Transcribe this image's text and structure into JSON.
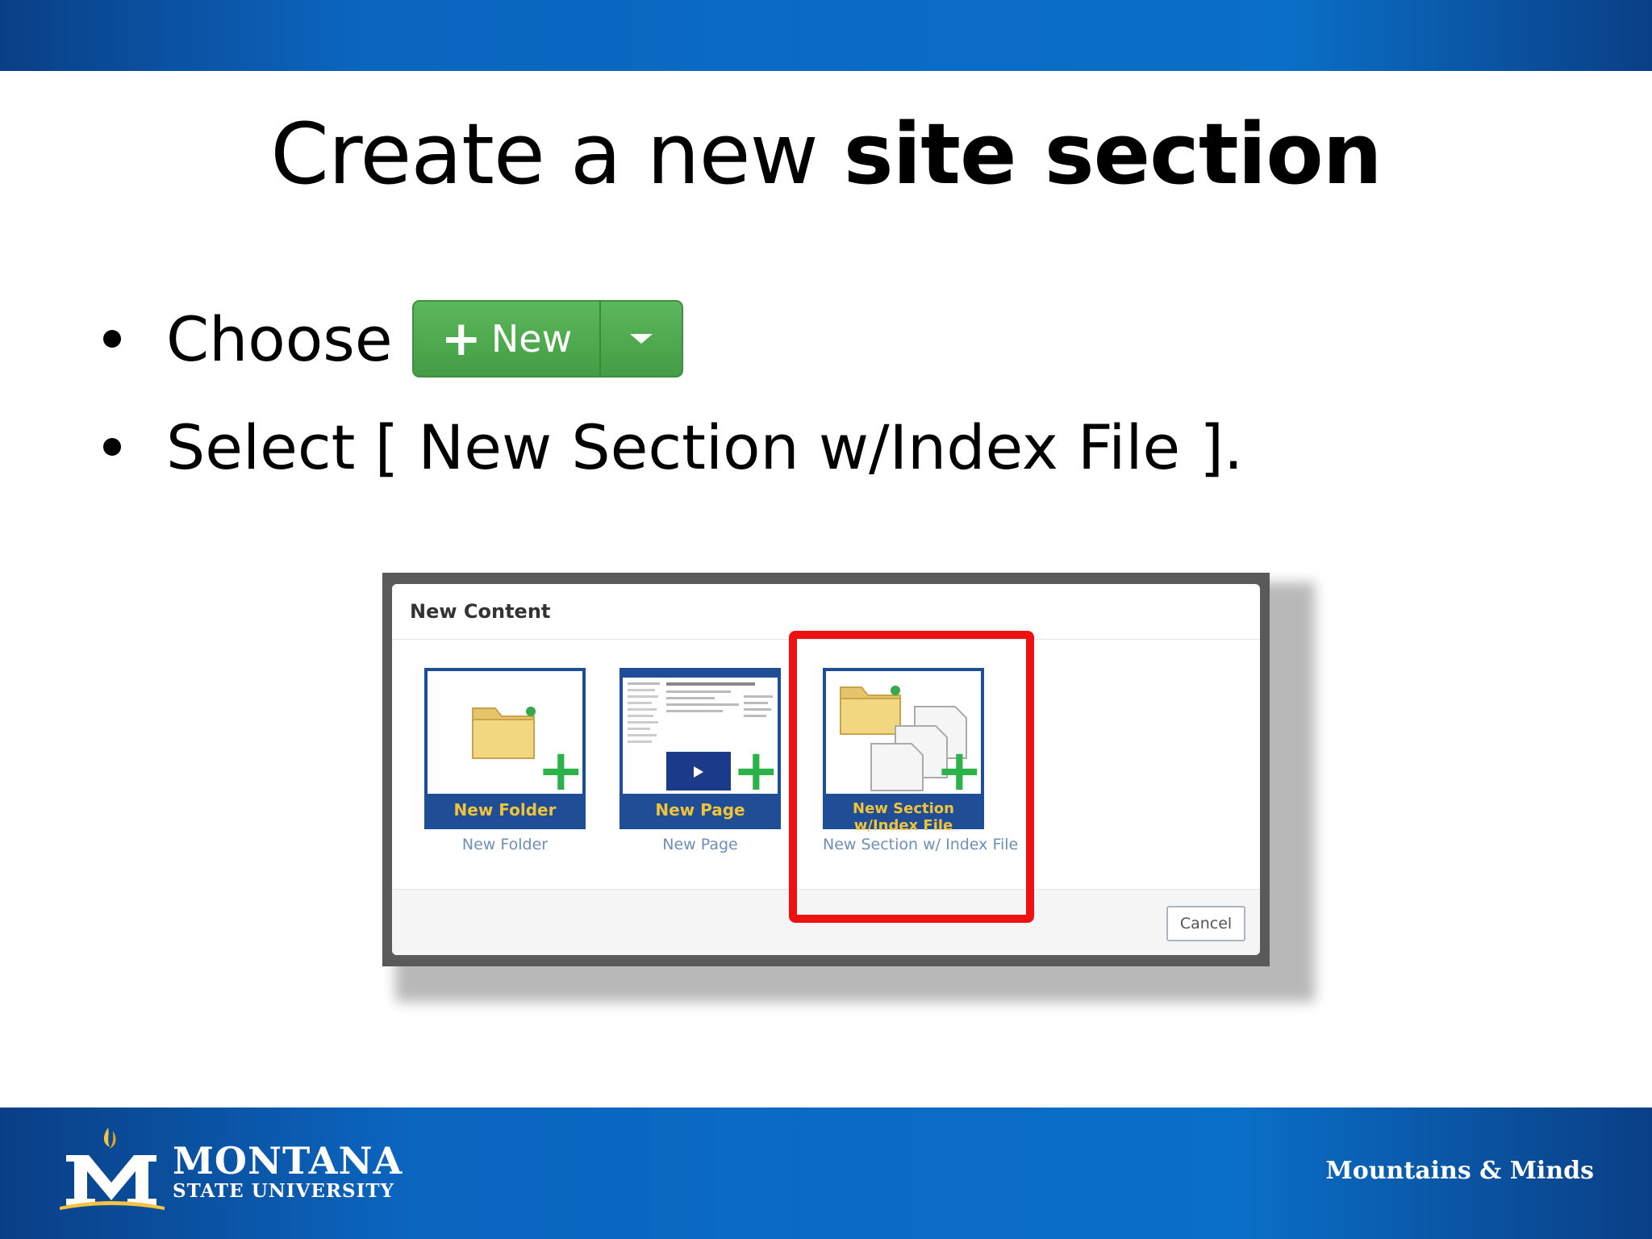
{
  "slide": {
    "title_normal": "Create a new ",
    "title_bold": "site section"
  },
  "bullets": {
    "choose": "Choose",
    "new_button": "New",
    "select": "Select [ New Section w/Index File ]."
  },
  "dialog": {
    "title": "New Content",
    "tiles": [
      {
        "label": "New Folder",
        "caption": "New Folder"
      },
      {
        "label": "New Page",
        "caption": "New Page"
      },
      {
        "label": "New Section w/Index File",
        "caption": "New Section w/ Index File"
      }
    ],
    "cancel": "Cancel"
  },
  "footer": {
    "logo_name": "MONTANA",
    "logo_sub": "STATE UNIVERSITY",
    "tagline": "Mountains & Minds"
  },
  "colors": {
    "brand_blue": "#0b66c0",
    "button_green": "#5cb85c",
    "highlight_red": "#ee1111",
    "tile_label": "#f0c43a"
  }
}
